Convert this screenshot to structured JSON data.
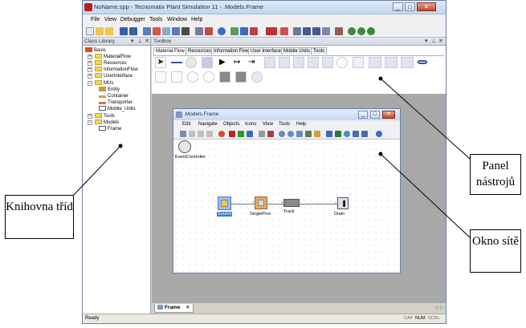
{
  "window": {
    "title": "NoName.spp - Tecnomatix Plant Simulation 11 - .Models.Frame",
    "controls": {
      "minimize": "_",
      "maximize": "□",
      "close": "✕"
    }
  },
  "menubar": [
    "File",
    "View",
    "Debugger",
    "Tools",
    "Window",
    "Help"
  ],
  "class_library": {
    "title": "Class Library",
    "items": [
      {
        "label": "Basis",
        "icon": "basis-icon"
      },
      {
        "label": "MaterialFlow",
        "icon": "folder-icon"
      },
      {
        "label": "Resources",
        "icon": "folder-icon"
      },
      {
        "label": "InformationFlow",
        "icon": "folder-icon"
      },
      {
        "label": "UserInterface",
        "icon": "folder-icon"
      },
      {
        "label": "MUs",
        "icon": "folder-icon"
      },
      {
        "label": "Entity",
        "icon": "entity-icon"
      },
      {
        "label": "Container",
        "icon": "container-icon"
      },
      {
        "label": "Transporter",
        "icon": "transporter-icon"
      },
      {
        "label": "Mobile_Units",
        "icon": "mobile-units-icon"
      },
      {
        "label": "Tools",
        "icon": "folder-icon"
      },
      {
        "label": "Models",
        "icon": "folder-icon"
      },
      {
        "label": "Frame",
        "icon": "frame-icon"
      }
    ]
  },
  "toolbox": {
    "title": "Toolbox",
    "tabs": [
      "Material Flow",
      "Resources",
      "Information Flow",
      "User Interface",
      "Mobile Units",
      "Tools"
    ]
  },
  "model_window": {
    "title": ".Models.Frame",
    "menu": [
      "Edit",
      "Navigate",
      "Objects",
      "Icons",
      "View",
      "Tools",
      "Help"
    ],
    "objects": {
      "event_controller": "EventController",
      "source": "Source",
      "single_proc": "SingleProc",
      "track": "Track",
      "drain": "Drain"
    }
  },
  "bottom_tab": {
    "label": "Frame",
    "close": "✕"
  },
  "statusbar": {
    "left": "Ready",
    "cap": "CAP",
    "num": "NUM",
    "scrl": "SCRL"
  },
  "callouts": {
    "toolbox_panel": "Panel nástrojů",
    "class_library": "Knihovna tříd",
    "network_window": "Okno sítě"
  }
}
